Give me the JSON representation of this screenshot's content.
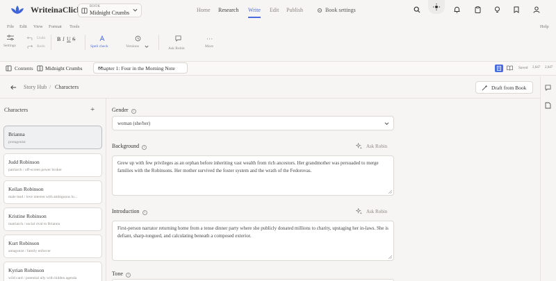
{
  "app": {
    "name": "WriteinaClick"
  },
  "book": {
    "caption": "BOOK",
    "title": "Midnight Crumbs"
  },
  "nav": {
    "home": "Home",
    "research": "Research",
    "write": "Write",
    "edit": "Edit",
    "publish": "Publish",
    "book_settings": "Book settings"
  },
  "menu": {
    "file": "File",
    "edit": "Edit",
    "view": "View",
    "format": "Format",
    "tools": "Tools",
    "help": "Help"
  },
  "toolbar": {
    "settings": "Settings",
    "undo": "Undo",
    "redo": "Redo",
    "bold": "B",
    "italic": "I",
    "underline": "U",
    "strike": "S",
    "spell_check": "Spell check",
    "versions": "Versions",
    "ask_robin": "Ask Robin",
    "more": "More"
  },
  "tabbar": {
    "contents": "Contents",
    "book_tab": "Midnight Crumbs",
    "chapter": "Chapter 1: Four in the Morning Note",
    "saved": "Saved",
    "count1": "2,647",
    "count2": "2,647"
  },
  "breadcrumb": {
    "hub": "Story Hub",
    "separator": "/",
    "current": "Characters",
    "draft_button": "Draft from Book"
  },
  "characters": {
    "heading": "Characters",
    "add": "+",
    "items": [
      {
        "name": "Brianna",
        "role": "protagonist"
      },
      {
        "name": "Judd Robinson",
        "role": "patriarch / off-screen power broker"
      },
      {
        "name": "Keilan Robinson",
        "role": "male lead / love interest with ambiguous lo..."
      },
      {
        "name": "Kristine Robinson",
        "role": "matriarch / social rival to Brianna"
      },
      {
        "name": "Kurt Robinson",
        "role": "antagonist / family enforcer"
      },
      {
        "name": "Kyrian Robinson",
        "role": "wild card / potential ally with hidden agenda"
      }
    ]
  },
  "form": {
    "gender_label": "Gender",
    "gender_value": "woman (she/her)",
    "background_label": "Background",
    "background_text": "Grew up with few privileges as an orphan before inheriting vast wealth from rich ancestors. Her grandmother was persuaded to merge families with the Robinsons. Her mother survived the foster system and the wrath of the Fedorovas.",
    "introduction_label": "Introduction",
    "introduction_text": "First-person narrator returning home from a tense dinner party where she publicly donated millions to charity, upstaging her in-laws. She is defiant, sharp-tongued, and calculating beneath a composed exterior.",
    "tone_label": "Tone",
    "ask_robin": "Ask Robin",
    "info": "i"
  },
  "colors": {
    "accent": "#4a6ae0",
    "background": "#f7f5f3",
    "selected_card": "#eef0f2"
  }
}
